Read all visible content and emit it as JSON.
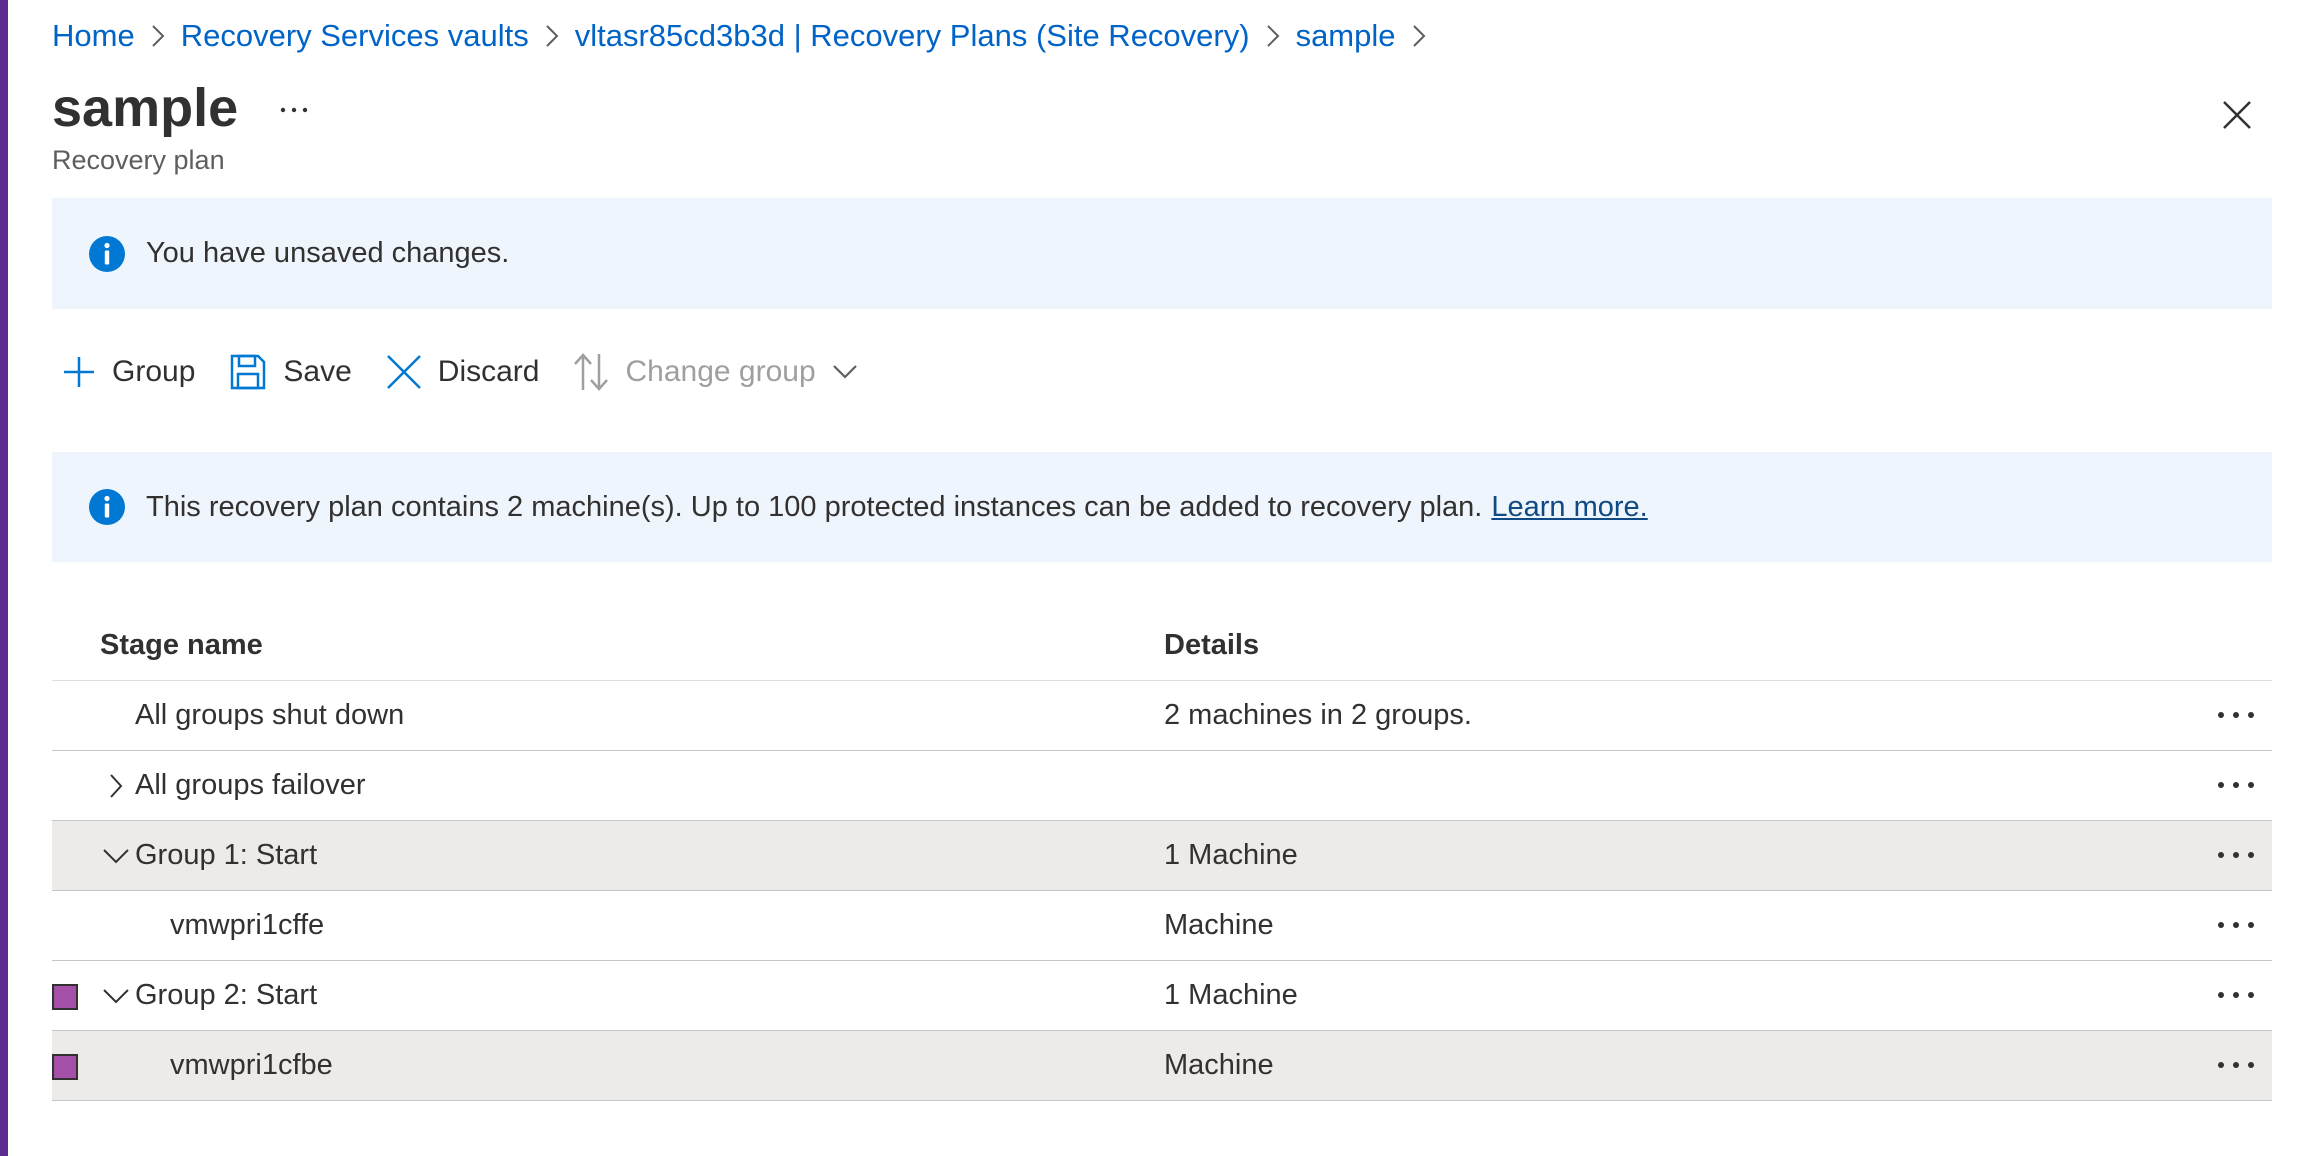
{
  "breadcrumb": {
    "items": [
      "Home",
      "Recovery Services vaults",
      "vltasr85cd3b3d | Recovery Plans (Site Recovery)",
      "sample"
    ]
  },
  "page": {
    "title": "sample",
    "subtitle": "Recovery plan"
  },
  "banner_unsaved": {
    "text": "You have unsaved changes."
  },
  "toolbar": {
    "group_label": "Group",
    "save_label": "Save",
    "discard_label": "Discard",
    "change_group_label": "Change group"
  },
  "banner_info": {
    "text": "This recovery plan contains 2 machine(s). Up to 100 protected instances can be added to recovery plan.",
    "link": "Learn more."
  },
  "grid": {
    "headers": {
      "stage": "Stage name",
      "details": "Details"
    },
    "rows": [
      {
        "stage": "All groups shut down",
        "details": "2 machines in 2 groups.",
        "expander": "none",
        "selected": false,
        "shaded": false,
        "indent": 1
      },
      {
        "stage": "All groups failover",
        "details": "",
        "expander": "collapsed",
        "selected": false,
        "shaded": false,
        "indent": 1
      },
      {
        "stage": "Group 1: Start",
        "details": "1 Machine",
        "expander": "expanded",
        "selected": false,
        "shaded": true,
        "indent": 1
      },
      {
        "stage": "vmwpri1cffe",
        "details": "Machine",
        "expander": "none",
        "selected": false,
        "shaded": false,
        "indent": 2
      },
      {
        "stage": "Group 2: Start",
        "details": "1 Machine",
        "expander": "expanded",
        "selected": true,
        "shaded": false,
        "indent": 1
      },
      {
        "stage": "vmwpri1cfbe",
        "details": "Machine",
        "expander": "none",
        "selected": true,
        "shaded": true,
        "indent": 2
      }
    ]
  },
  "colors": {
    "accent_left_bar": "#5c2d91",
    "link": "#0063c7",
    "info_icon": "#0078d4",
    "banner_bg": "#eff5fc",
    "selected_checkbox": "#a450a8",
    "row_shade": "#edebe9"
  },
  "icons": {
    "breadcrumb_separator": "chevron-right-icon",
    "title_more": "more-horizontal-icon",
    "close": "close-icon",
    "info": "info-icon",
    "add": "plus-icon",
    "save": "save-icon",
    "discard": "close-icon",
    "change_group": "sort-arrows-icon",
    "dropdown": "chevron-down-icon",
    "row_more": "more-horizontal-icon"
  }
}
